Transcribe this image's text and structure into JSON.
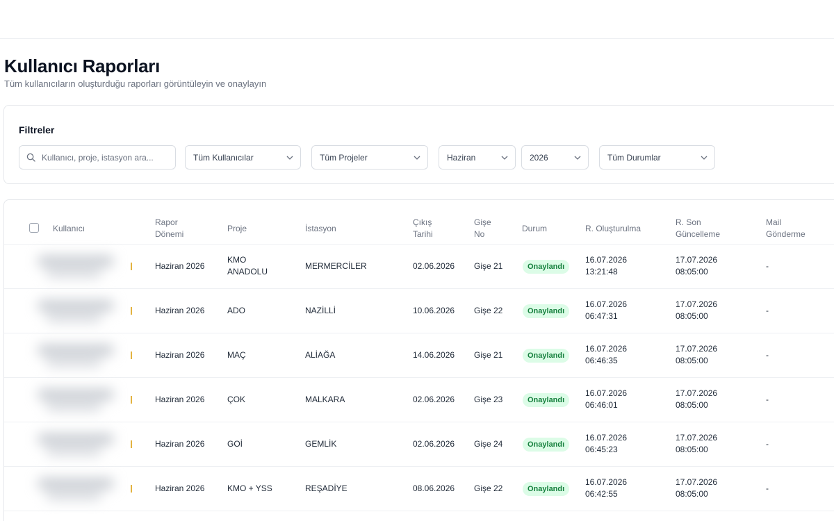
{
  "page": {
    "title": "Kullanıcı Raporları",
    "subtitle": "Tüm kullanıcıların oluşturduğu raporları görüntüleyin ve onaylayın"
  },
  "filters": {
    "title": "Filtreler",
    "search_placeholder": "Kullanıcı, proje, istasyon ara...",
    "users": "Tüm Kullanıcılar",
    "projects": "Tüm Projeler",
    "month": "Haziran",
    "year": "2026",
    "status": "Tüm Durumlar"
  },
  "table": {
    "headers": {
      "user": "Kullanıcı",
      "period_1": "Rapor",
      "period_2": "Dönemi",
      "project": "Proje",
      "station": "İstasyon",
      "exit_1": "Çıkış",
      "exit_2": "Tarihi",
      "gate_1": "Gişe",
      "gate_2": "No",
      "status": "Durum",
      "created": "R. Oluşturulma",
      "updated_1": "R. Son",
      "updated_2": "Güncelleme",
      "mail_1": "Mail",
      "mail_2": "Gönderme"
    },
    "rows": [
      {
        "period": "Haziran 2026",
        "project_1": "KMO",
        "project_2": "ANADOLU",
        "station": "MERMERCİLER",
        "exit": "02.06.2026",
        "gate": "Gişe 21",
        "status": "Onaylandı",
        "created_date": "16.07.2026",
        "created_time": "13:21:48",
        "updated_date": "17.07.2026",
        "updated_time": "08:05:00",
        "mail": "-"
      },
      {
        "period": "Haziran 2026",
        "project_1": "ADO",
        "project_2": "",
        "station": "NAZİLLİ",
        "exit": "10.06.2026",
        "gate": "Gişe 22",
        "status": "Onaylandı",
        "created_date": "16.07.2026",
        "created_time": "06:47:31",
        "updated_date": "17.07.2026",
        "updated_time": "08:05:00",
        "mail": "-"
      },
      {
        "period": "Haziran 2026",
        "project_1": "MAÇ",
        "project_2": "",
        "station": "ALİAĞA",
        "exit": "14.06.2026",
        "gate": "Gişe 21",
        "status": "Onaylandı",
        "created_date": "16.07.2026",
        "created_time": "06:46:35",
        "updated_date": "17.07.2026",
        "updated_time": "08:05:00",
        "mail": "-"
      },
      {
        "period": "Haziran 2026",
        "project_1": "ÇOK",
        "project_2": "",
        "station": "MALKARA",
        "exit": "02.06.2026",
        "gate": "Gişe 23",
        "status": "Onaylandı",
        "created_date": "16.07.2026",
        "created_time": "06:46:01",
        "updated_date": "17.07.2026",
        "updated_time": "08:05:00",
        "mail": "-"
      },
      {
        "period": "Haziran 2026",
        "project_1": "GOİ",
        "project_2": "",
        "station": "GEMLİK",
        "exit": "02.06.2026",
        "gate": "Gişe 24",
        "status": "Onaylandı",
        "created_date": "16.07.2026",
        "created_time": "06:45:23",
        "updated_date": "17.07.2026",
        "updated_time": "08:05:00",
        "mail": "-"
      },
      {
        "period": "Haziran 2026",
        "project_1": "KMO + YSS",
        "project_2": "",
        "station": "REŞADİYE",
        "exit": "08.06.2026",
        "gate": "Gişe 22",
        "status": "Onaylandı",
        "created_date": "16.07.2026",
        "created_time": "06:42:55",
        "updated_date": "17.07.2026",
        "updated_time": "08:05:00",
        "mail": "-"
      }
    ]
  },
  "colors": {
    "status_bg": "#dcfce7",
    "status_text": "#15803d"
  }
}
